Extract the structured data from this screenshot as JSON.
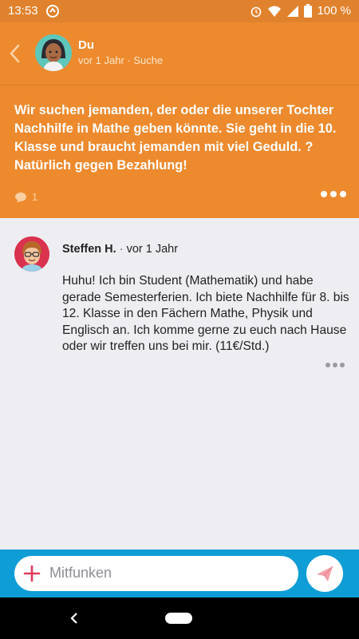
{
  "status": {
    "time": "13:53",
    "battery": "100 %"
  },
  "header": {
    "name": "Du",
    "meta": "vor 1 Jahr · Suche"
  },
  "post": {
    "text": "Wir suchen jemanden, der oder die unserer Tochter Nachhilfe in Mathe geben könnte. Sie geht in die 10. Klasse und braucht jemanden mit viel Geduld. ? Natürlich gegen Bezahlung!",
    "comment_count": "1"
  },
  "reply": {
    "author": "Steffen H.",
    "separator": "·",
    "time": "vor 1 Jahr",
    "text": "Huhu! Ich bin Student (Mathematik) und habe gerade Semesterferien. Ich biete Nachhilfe für 8. bis 12. Klasse in den Fächern Mathe, Physik und Englisch an. Ich komme gerne zu euch nach Hause oder wir treffen uns bei mir. (11€/Std.)"
  },
  "composer": {
    "placeholder": "Mitfunken"
  },
  "colors": {
    "orange": "#ed8a2e",
    "blue": "#0f9dd6",
    "accent_red": "#e03a5a",
    "send_pink": "#f4a0a8"
  },
  "icons": [
    "back-arrow-icon",
    "alarm-icon",
    "wifi-icon",
    "signal-icon",
    "battery-icon",
    "comment-icon",
    "more-icon",
    "plus-icon",
    "send-icon"
  ]
}
